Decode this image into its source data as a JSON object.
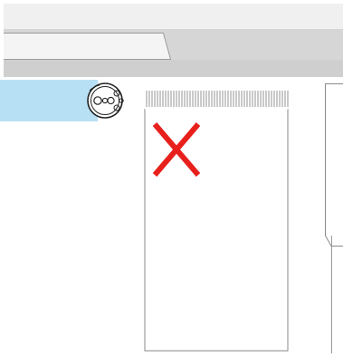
{
  "window": {
    "title": "",
    "tabs": [
      {
        "label": ""
      }
    ]
  },
  "sidebar": {
    "selected_item_label": ""
  },
  "icons": {
    "drive": "optical-disc-icon",
    "status": "red-x-icon"
  },
  "colors": {
    "selection": "#b8e0f5",
    "error_mark": "#e8201c",
    "tabstrip": "#d6d6d6"
  }
}
